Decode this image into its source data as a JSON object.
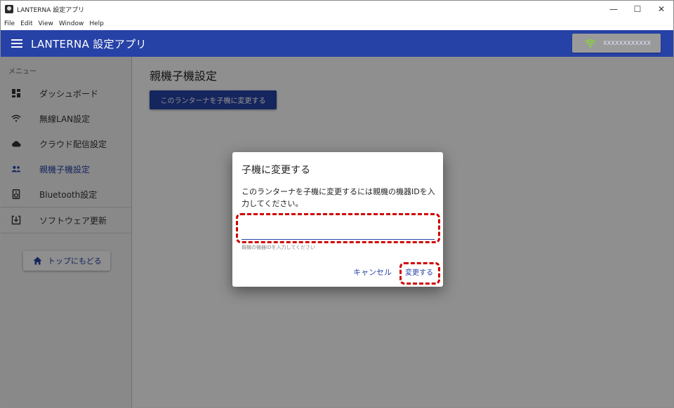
{
  "window": {
    "title": "LANTERNA 設定アプリ",
    "controls": {
      "minimize": "—",
      "maximize": "☐",
      "close": "✕"
    }
  },
  "menubar": {
    "items": [
      "File",
      "Edit",
      "View",
      "Window",
      "Help"
    ]
  },
  "appbar": {
    "title": "LANTERNA 設定アプリ",
    "wifi_ssid": "XXXXXXXXXXXX",
    "wifi_icon": "wifi-icon",
    "colors": {
      "bar": "#2742a6",
      "wifi": "#8bd33a"
    }
  },
  "sidebar": {
    "header": "メニュー",
    "items": [
      {
        "label": "ダッシュボード",
        "icon": "dashboard-icon"
      },
      {
        "label": "無線LAN設定",
        "icon": "wifi-icon"
      },
      {
        "label": "クラウド配信設定",
        "icon": "cloud-icon"
      },
      {
        "label": "親機子機設定",
        "icon": "people-icon",
        "active": true
      },
      {
        "label": "Bluetooth設定",
        "icon": "speaker-icon"
      },
      {
        "label": "ソフトウェア更新",
        "icon": "download-icon"
      }
    ],
    "home_button": "トップにもどる"
  },
  "main": {
    "page_title": "親機子機設定",
    "primary_button": "このランターナを子機に変更する"
  },
  "dialog": {
    "title": "子機に変更する",
    "message": "このランターナを子機に変更するには親機の機器IDを入力してください。",
    "input_value": "",
    "helper": "親機の機器IDを入力してください",
    "cancel_label": "キャンセル",
    "confirm_label": "変更する"
  },
  "annotation_color": "#d00000"
}
